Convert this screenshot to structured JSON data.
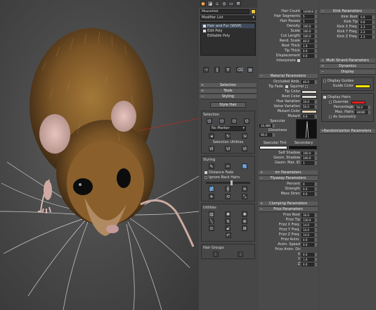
{
  "tabs": [
    "Create",
    "Modify",
    "Hierarchy",
    "Motion",
    "Display",
    "Utilities"
  ],
  "modifier": {
    "object_name": "MouseHair",
    "list_label": "Modifier List",
    "stack": [
      "Hair and Fur (WSM)",
      "Edit Poly",
      "Editable Poly"
    ]
  },
  "rollouts": {
    "selection": "Selection",
    "tools": "Tools",
    "styling": "Styling"
  },
  "styling": {
    "style_hair": "Style Hair",
    "selection_header": "Selection",
    "marker": "No Marker",
    "selection_utilities": "Selection Utilities",
    "styling_header": "Styling",
    "distance_fade": "Distance Fade",
    "ignore_back_hairs": "Ignore Back Hairs",
    "utilities_header": "Utilities",
    "hair_groups": "Hair Groups"
  },
  "general": [
    {
      "label": "Hair Count",
      "value": "100000"
    },
    {
      "label": "Hair Segments",
      "value": "5"
    },
    {
      "label": "Hair Passes",
      "value": "1"
    },
    {
      "label": "Density",
      "value": "100.0"
    },
    {
      "label": "Scale",
      "value": "100.0"
    },
    {
      "label": "Cut Length",
      "value": "100.0"
    },
    {
      "label": "Rand. Scale",
      "value": "40.0"
    },
    {
      "label": "Root Thick",
      "value": "1.9"
    },
    {
      "label": "Tip Thick",
      "value": "0.0"
    },
    {
      "label": "Displacement",
      "value": "0.0"
    }
  ],
  "interpolate": "Interpolate",
  "material": {
    "title": "Material Parameters",
    "occluded_amb": {
      "label": "Occluded Amb.",
      "value": "40.0"
    },
    "tip_fade": "Tip Fade",
    "squirrel": "Squirrel",
    "tip_color": {
      "label": "Tip Color",
      "color": "#d8d4cc"
    },
    "root_color": {
      "label": "Root Color",
      "color": "#d9d6d0"
    },
    "hue_variation": {
      "label": "Hue Variation",
      "value": "10.0"
    },
    "value_variation": {
      "label": "Value Variation",
      "value": "50.0"
    },
    "mutant_color": {
      "label": "Mutant Color",
      "color": "#e4cfb0"
    },
    "mutant": {
      "label": "Mutant",
      "value": "0.0"
    },
    "specular": {
      "label": "Specular",
      "value": "34.486"
    },
    "glossiness": {
      "label": "Glossiness",
      "value": "90.0"
    },
    "specular_tint": "Specular Tint",
    "secondary": "Secondary",
    "self_shadow": {
      "label": "Self Shadow",
      "value": "100.0"
    },
    "geom_shadow": {
      "label": "Geom. Shadow",
      "value": "100.0"
    },
    "geom_mat_id": {
      "label": "Geom. Mat. ID",
      "value": "1"
    }
  },
  "mr_params": "mr Parameters",
  "flyaway": {
    "title": "Flyaway Parameters",
    "rows": [
      {
        "label": "Percent",
        "value": "0"
      },
      {
        "label": "Strength",
        "value": "0.0"
      },
      {
        "label": "Mess Stren",
        "value": "0.0"
      }
    ]
  },
  "clumping": "Clumping Parameters",
  "frizz": {
    "title": "Frizz Parameters",
    "rows": [
      {
        "label": "Frizz Root",
        "value": "16.0"
      },
      {
        "label": "Frizz Tip",
        "value": "130.0"
      },
      {
        "label": "Frizz X Freq.",
        "value": "14.0"
      },
      {
        "label": "Frizz Y Freq.",
        "value": "14.0"
      },
      {
        "label": "Frizz Z Freq.",
        "value": "14.0"
      },
      {
        "label": "Frizz Anim.",
        "value": "0.0"
      },
      {
        "label": "Anim. Speed",
        "value": "0.0"
      }
    ],
    "anim_dir": "Frizz Anim. Dir.",
    "dirs": [
      {
        "label": "X",
        "value": "0.0"
      },
      {
        "label": "Y",
        "value": "1.0"
      },
      {
        "label": "Z",
        "value": "0.0"
      }
    ]
  },
  "kink": {
    "title": "Kink Parameters",
    "rows": [
      {
        "label": "Kink Root",
        "value": "0.0"
      },
      {
        "label": "Kink Tip",
        "value": "0.0"
      },
      {
        "label": "Kink X Freq.",
        "value": "2.3"
      },
      {
        "label": "Kink Y Freq.",
        "value": "2.3"
      },
      {
        "label": "Kink Z Freq.",
        "value": "2.3"
      }
    ]
  },
  "multi_strand": "Multi Strand Parameters",
  "dynamics": "Dynamics",
  "display": {
    "title": "Display",
    "display_guides": "Display Guides",
    "guide_color_label": "Guide Color",
    "guide_color": "#ffe600",
    "display_hairs": "Display Hairs",
    "override": "Override",
    "override_color": "#e02020",
    "percentage": {
      "label": "Percentage",
      "value": "50.0"
    },
    "max_hairs": {
      "label": "Max. Hairs",
      "value": "30000"
    },
    "as_geometry": "As Geometry"
  },
  "randomization": "Randomization Parameters"
}
